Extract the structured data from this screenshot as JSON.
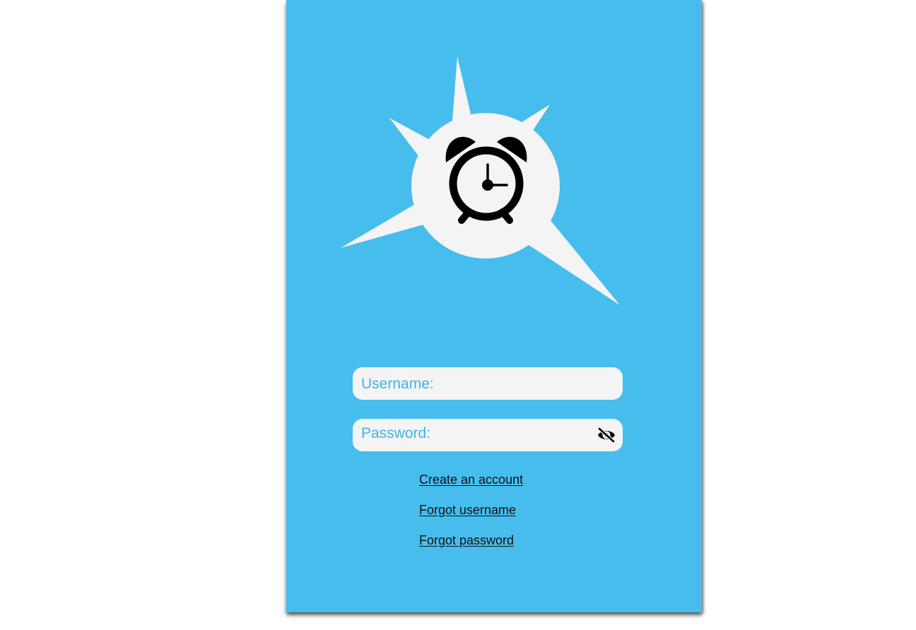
{
  "colors": {
    "panel_background": "#47bdee",
    "field_background": "#f4f4f4",
    "field_label": "#3fb3e6",
    "logo_burst": "#f4f4f4",
    "logo_icon": "#000000",
    "link_text": "#111111"
  },
  "logo": {
    "icon": "alarm-clock-icon",
    "background": "starburst"
  },
  "login_form": {
    "username": {
      "label": "Username:",
      "value": ""
    },
    "password": {
      "label": "Password:",
      "value": "",
      "toggle_icon": "eye-off-icon"
    }
  },
  "links": {
    "create_account": "Create an account",
    "forgot_username": "Forgot username",
    "forgot_password": "Forgot password"
  }
}
